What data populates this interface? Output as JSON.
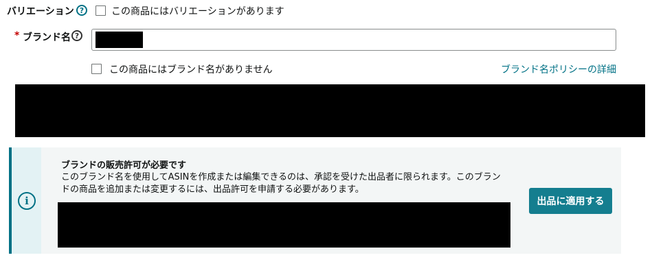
{
  "variation": {
    "label": "バリエーション",
    "help_icon": "question-circle-icon",
    "checkbox_label": "この商品にはバリエーションがあります",
    "checked": false
  },
  "brand": {
    "required_mark": "*",
    "label": "ブランド名",
    "help_icon": "question-circle-icon",
    "no_brand_checkbox_label": "この商品にはブランド名がありません",
    "no_brand_checked": false,
    "policy_link": "ブランド名ポリシーの詳細"
  },
  "alert": {
    "icon": "info-circle-icon",
    "title": "ブランドの販売許可が必要です",
    "body_line1": "このブランド名を使用してASINを作成または編集できるのは、承認を受けた出品者に限られます。このブラン",
    "body_line2": "ドの商品を追加または変更するには、出品許可を申請する必要があります。",
    "apply_button": "出品に適用する"
  },
  "colors": {
    "accent": "#007185",
    "button": "#147e8f",
    "alert_bg": "#f3f6f6",
    "required": "#c40000"
  }
}
